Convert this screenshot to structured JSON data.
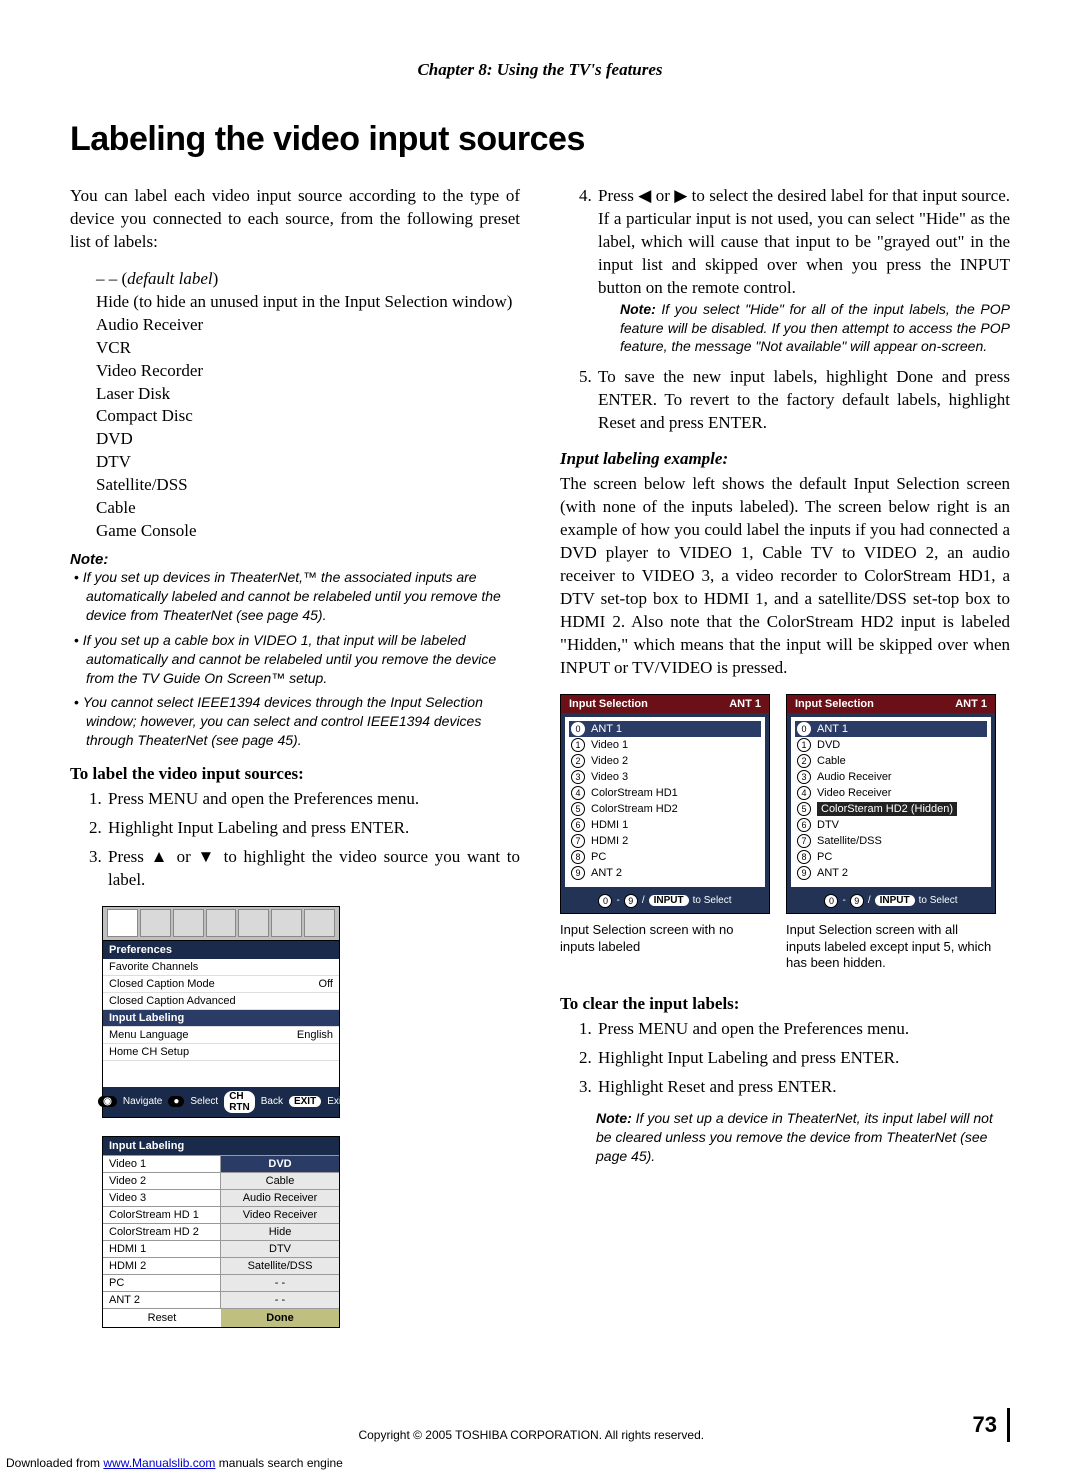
{
  "chapter_header": "Chapter 8: Using the TV's features",
  "page_title": "Labeling the video input sources",
  "left": {
    "intro": "You can label each video input source according to the type of device you connected to each source, from the following preset list of labels:",
    "labels_pre_default_dashes": "– – (",
    "labels_default": "default label",
    "labels_post_paren": ")",
    "labels": [
      "Hide (to hide an unused input in the Input Selection window)",
      "Audio Receiver",
      "VCR",
      "Video Recorder",
      "Laser Disk",
      "Compact Disc",
      "DVD",
      "DTV",
      "Satellite/DSS",
      "Cable",
      "Game Console"
    ],
    "note_heading": "Note:",
    "note_bullets": [
      "If you set up devices in TheaterNet,™ the associated inputs are automatically labeled and cannot be relabeled until you remove the device from TheaterNet (see page 45).",
      "If you set up a cable box in VIDEO 1, that input will be labeled automatically and cannot be relabeled until you remove the device from the TV Guide On Screen™ setup.",
      "You cannot select IEEE1394 devices through the Input Selection window; however, you can select and control IEEE1394 devices through TheaterNet (see page 45)."
    ],
    "to_label_heading": "To label the video input sources:",
    "steps": [
      "Press MENU and open the Preferences menu.",
      "Highlight Input Labeling and press ENTER.",
      "Press ▲ or ▼ to highlight the video source you want to label."
    ],
    "menu": {
      "prefs_label": "Preferences",
      "rows": [
        {
          "l": "Favorite Channels",
          "r": ""
        },
        {
          "l": "Closed Caption Mode",
          "r": "Off"
        },
        {
          "l": "Closed Caption Advanced",
          "r": ""
        },
        {
          "l": "Input Labeling",
          "r": "",
          "hl": true
        },
        {
          "l": "Menu Language",
          "r": "English"
        },
        {
          "l": "Home CH Setup",
          "r": ""
        }
      ],
      "footer": {
        "navigate": "Navigate",
        "select": "Select",
        "back": "Back",
        "back_key": "CH RTN",
        "exit": "Exit",
        "exit_key": "EXIT"
      }
    },
    "il_table": {
      "header": "Input Labeling",
      "rows": [
        {
          "src": "Video 1",
          "lbl": "DVD",
          "sel": true
        },
        {
          "src": "Video 2",
          "lbl": "Cable"
        },
        {
          "src": "Video 3",
          "lbl": "Audio Receiver"
        },
        {
          "src": "ColorStream HD 1",
          "lbl": "Video Receiver"
        },
        {
          "src": "ColorStream HD 2",
          "lbl": "Hide"
        },
        {
          "src": "HDMI 1",
          "lbl": "DTV"
        },
        {
          "src": "HDMI 2",
          "lbl": "Satellite/DSS"
        },
        {
          "src": "PC",
          "lbl": "- -"
        },
        {
          "src": "ANT 2",
          "lbl": "- -"
        }
      ],
      "reset": "Reset",
      "done": "Done"
    }
  },
  "right": {
    "step4": "Press ◀ or ▶ to select the desired label for that input source. If a particular input is not used, you can select \"Hide\" as the label, which will cause that input to be \"grayed out\" in the input list and skipped over when you press the INPUT button on the remote control.",
    "step4_note_label": "Note:",
    "step4_note_body": " If you select \"Hide\" for all of the input labels, the POP feature will be disabled. If you then attempt to access the POP feature, the message \"Not available\" will appear on-screen.",
    "step5": "To save the new input labels, highlight Done and press ENTER. To revert to the factory default labels, highlight Reset and press ENTER.",
    "example_heading": "Input labeling example:",
    "example_para": "The screen below left shows the default Input Selection screen (with none of the inputs labeled). The screen below right is an example of how you could label the inputs if you had connected a DVD player to VIDEO 1, Cable TV to VIDEO 2, an audio receiver to VIDEO 3, a video recorder to ColorStream HD1, a DTV set-top box to HDMI 1, and a satellite/DSS set-top box to HDMI 2. Also note that the ColorStream HD2 input is labeled \"Hidden,\" which means that the input will be skipped over when INPUT or TV/VIDEO is pressed.",
    "screen_left": {
      "title": "Input Selection",
      "ant": "ANT 1",
      "items": [
        "ANT 1",
        "Video 1",
        "Video 2",
        "Video 3",
        "ColorStream HD1",
        "ColorStream HD2",
        "HDMI 1",
        "HDMI 2",
        "PC",
        "ANT 2"
      ],
      "footer_a": "0",
      "footer_b": "9",
      "footer_key": "INPUT",
      "footer_tail": "to Select"
    },
    "screen_right": {
      "title": "Input Selection",
      "ant": "ANT 1",
      "items": [
        "ANT 1",
        "DVD",
        "Cable",
        "Audio Receiver",
        "Video Receiver"
      ],
      "hidden_item": "ColorSteram HD2 (Hidden)",
      "items_tail": [
        "DTV",
        "Satellite/DSS",
        "PC",
        "ANT 2"
      ],
      "footer_a": "0",
      "footer_b": "9",
      "footer_key": "INPUT",
      "footer_tail": "to Select"
    },
    "caption_left": "Input Selection screen with no inputs labeled",
    "caption_right": "Input Selection screen with all inputs labeled except input 5, which has been hidden.",
    "to_clear_heading": "To clear the input labels:",
    "clear_steps": [
      "Press MENU and open the Preferences menu.",
      "Highlight Input Labeling and press ENTER.",
      "Highlight Reset and press ENTER."
    ],
    "clear_note_label": "Note:",
    "clear_note_body": " If you set up a device in TheaterNet, its input label will not be cleared unless you remove the device from TheaterNet (see page 45)."
  },
  "footer": {
    "copyright": "Copyright © 2005 TOSHIBA CORPORATION. All rights reserved.",
    "page_number": "73",
    "download_prefix": "Downloaded from ",
    "download_link_text": "www.Manualslib.com",
    "download_suffix": " manuals search engine"
  }
}
